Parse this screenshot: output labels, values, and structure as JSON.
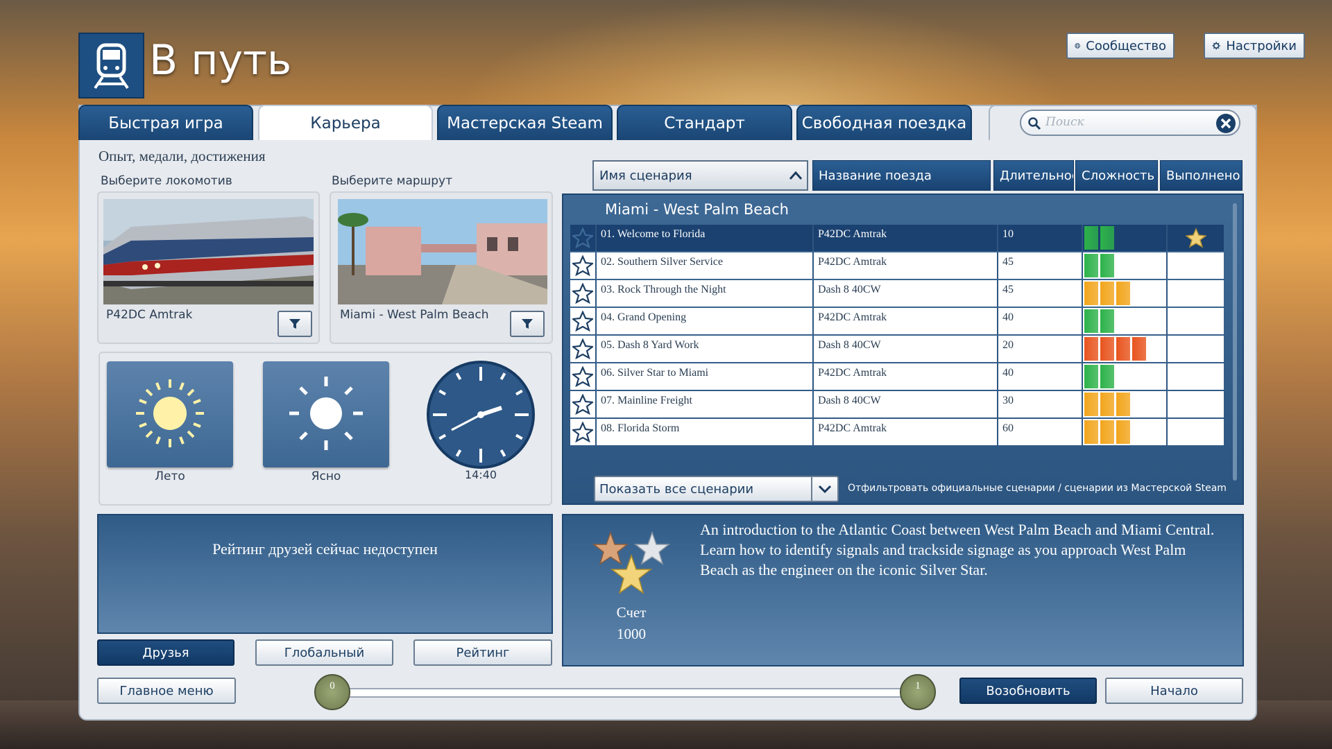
{
  "header": {
    "title": "В путь"
  },
  "top_buttons": {
    "community": "Сообщество",
    "settings": "Настройки"
  },
  "tabs": [
    {
      "label": "Быстрая игра"
    },
    {
      "label": "Карьера"
    },
    {
      "label": "Мастерская Steam"
    },
    {
      "label": "Стандарт"
    },
    {
      "label": "Свободная поездка"
    }
  ],
  "search": {
    "placeholder": "Поиск"
  },
  "left": {
    "section_title": "Опыт, медали, достижения",
    "loco_label": "Выберите локомотив",
    "route_label": "Выберите маршрут",
    "loco_name": "P42DC Amtrak",
    "route_name": "Miami - West Palm Beach",
    "season": "Лето",
    "weather": "Ясно",
    "time": "14:40",
    "leaderboard_msg": "Рейтинг друзей сейчас недоступен",
    "friends_btn": "Друзья",
    "global_btn": "Глобальный",
    "rating_btn": "Рейтинг"
  },
  "columns": {
    "scenario": "Имя сценария",
    "train": "Название поезда",
    "duration": "Длительнос",
    "difficulty": "Сложность",
    "completed": "Выполнено"
  },
  "route_group": "Miami - West Palm Beach",
  "scenarios": [
    {
      "name": "01. Welcome to Florida",
      "train": "P42DC Amtrak",
      "duration": "10",
      "difficulty": 2,
      "completed": true
    },
    {
      "name": "02. Southern Silver Service",
      "train": "P42DC Amtrak",
      "duration": "45",
      "difficulty": 2,
      "completed": false
    },
    {
      "name": "03. Rock Through the Night",
      "train": "Dash 8 40CW",
      "duration": "45",
      "difficulty": 3,
      "completed": false
    },
    {
      "name": "04. Grand Opening",
      "train": "P42DC Amtrak",
      "duration": "40",
      "difficulty": 2,
      "completed": false
    },
    {
      "name": "05. Dash 8 Yard Work",
      "train": "Dash 8 40CW",
      "duration": "20",
      "difficulty": 4,
      "completed": false
    },
    {
      "name": "06. Silver Star to Miami",
      "train": "P42DC Amtrak",
      "duration": "40",
      "difficulty": 2,
      "completed": false
    },
    {
      "name": "07. Mainline Freight",
      "train": "Dash 8 40CW",
      "duration": "30",
      "difficulty": 3,
      "completed": false
    },
    {
      "name": "08. Florida Storm",
      "train": "P42DC Amtrak",
      "duration": "60",
      "difficulty": 3,
      "completed": false
    }
  ],
  "difficulty_colors": {
    "2": "#2db24a",
    "3": "#f2a51c",
    "4": "#e8541e"
  },
  "filter": {
    "dropdown": "Показать все сценарии",
    "hint": "Отфильтровать официальные сценарии / сценарии из Мастерской Steam"
  },
  "details": {
    "description": "An introduction to the Atlantic Coast between West Palm Beach and Miami Central. Learn how to identify signals and trackside signage as you approach West Palm Beach as the engineer on the iconic Silver Star.",
    "score_label": "Счет",
    "score": "1000"
  },
  "bottom": {
    "main_menu": "Главное меню",
    "slider_min": "0",
    "slider_max": "1",
    "resume": "Возобновить",
    "start": "Начало"
  }
}
